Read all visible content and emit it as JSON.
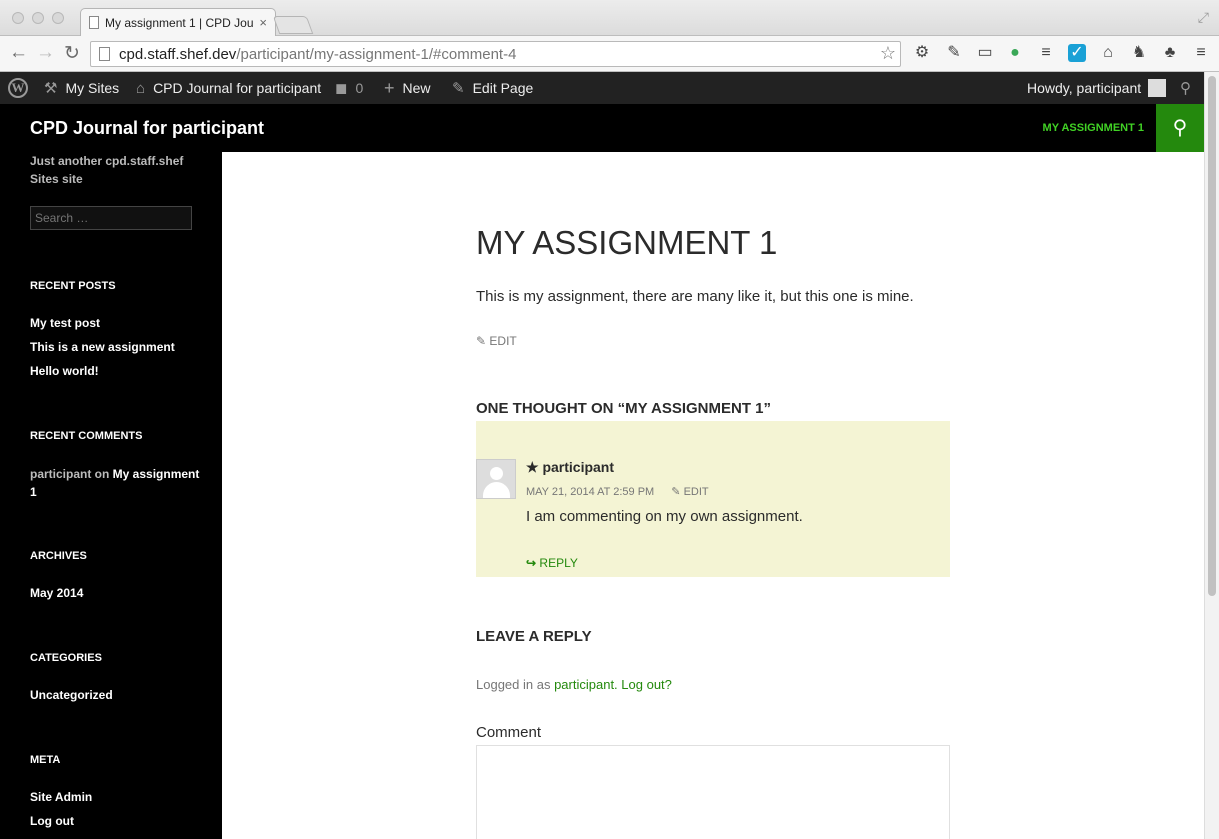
{
  "browser": {
    "tab_title": "My assignment 1 | CPD Jou",
    "tab_close": "×",
    "url_host": "cpd.staff.shef.dev",
    "url_path": "/participant/my-assignment-1/#comment-4"
  },
  "adminbar": {
    "my_sites": "My Sites",
    "site_name": "CPD Journal for participant",
    "comments_count": "0",
    "new": "New",
    "edit_page": "Edit Page",
    "howdy": "Howdy, participant"
  },
  "header": {
    "site_title": "CPD Journal for participant",
    "menu_item": "MY ASSIGNMENT 1"
  },
  "sidebar": {
    "tagline": "Just another cpd.staff.shef Sites site",
    "search_placeholder": "Search …",
    "recent_posts_title": "RECENT POSTS",
    "recent_posts": [
      "My test post",
      "This is a new assignment",
      "Hello world!"
    ],
    "recent_comments_title": "RECENT COMMENTS",
    "recent_comment_author": "participant",
    "recent_comment_on": " on ",
    "recent_comment_post": "My assignment 1",
    "archives_title": "ARCHIVES",
    "archive_item": "May 2014",
    "categories_title": "CATEGORIES",
    "category_item": "Uncategorized",
    "meta_title": "META",
    "meta_items": [
      "Site Admin",
      "Log out"
    ]
  },
  "post": {
    "title": "MY ASSIGNMENT 1",
    "body": "This is my assignment, there are many like it, but this one is mine.",
    "edit": "EDIT"
  },
  "comments": {
    "title": "ONE THOUGHT ON “MY ASSIGNMENT 1”",
    "author": "★ participant",
    "date": "MAY 21, 2014 AT 2:59 PM",
    "edit": "EDIT",
    "text": "I am commenting on my own assignment.",
    "reply": "REPLY"
  },
  "reply_form": {
    "title": "LEAVE A REPLY",
    "logged_in_prefix": "Logged in as ",
    "logged_in_user": "participant.",
    "logout": "Log out?",
    "comment_label": "Comment"
  },
  "colors": {
    "accent": "#24890d",
    "accent_light": "#41d225",
    "comment_bg": "#f4f4d4"
  }
}
